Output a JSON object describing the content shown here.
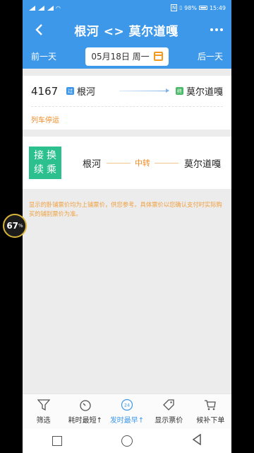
{
  "status_bar": {
    "left_text": "",
    "battery": "98%",
    "time": "15:49"
  },
  "header": {
    "title": "根河 <> 莫尔道嘎"
  },
  "date_bar": {
    "prev_day": "前一天",
    "date": "05月18日 周一",
    "next_day": "后一天"
  },
  "train": {
    "number": "4167",
    "from_badge": "过",
    "from_station": "根河",
    "to_badge": "终",
    "to_station": "莫尔道嘎",
    "status": "列车停运"
  },
  "transfer": {
    "tag_line1": "接换",
    "tag_line2": "续乘",
    "from_station": "根河",
    "via": "中转",
    "to_station": "莫尔道嘎"
  },
  "notice": "显示的卧铺票价均为上铺票价，供您参考。具体票价以您确认支付时实际购买的铺别票价为准。",
  "tab_bar": [
    {
      "label": "筛选",
      "icon": "filter-icon"
    },
    {
      "label": "耗时最短↑",
      "icon": "timer-icon"
    },
    {
      "label": "发时最早↑",
      "icon": "clock-24-icon",
      "active": true
    },
    {
      "label": "显示票价",
      "icon": "price-tag-icon"
    },
    {
      "label": "候补下单",
      "icon": "cart-icon"
    }
  ],
  "overlay_badge": {
    "value": "67",
    "unit": "%"
  },
  "colors": {
    "primary": "#3e98ea",
    "accent_orange": "#f08a24",
    "transfer_green": "#2bc08d"
  }
}
